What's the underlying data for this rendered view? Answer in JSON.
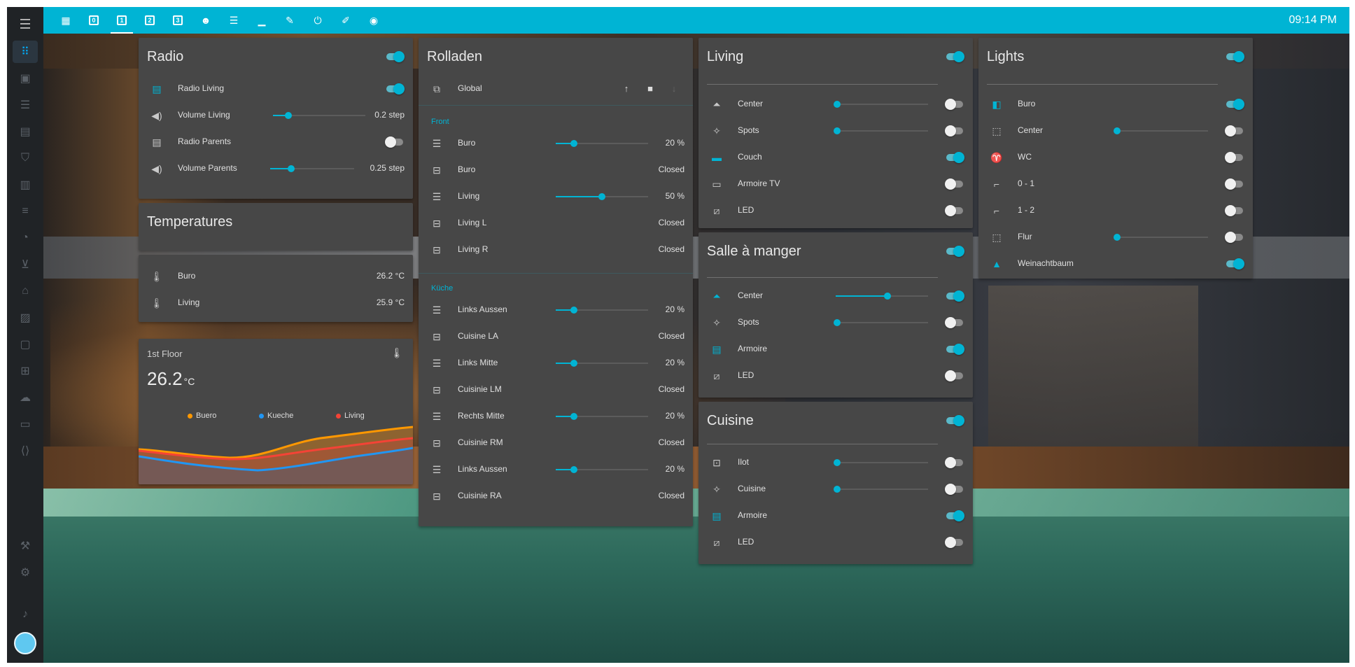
{
  "topbar": {
    "time": "09:14 PM",
    "views": [
      {
        "icon": "floorplan-icon",
        "glyph": "▦"
      },
      {
        "icon": "floor-0-icon",
        "glyph": "0"
      },
      {
        "icon": "floor-1-icon",
        "glyph": "1"
      },
      {
        "icon": "floor-2-icon",
        "glyph": "2"
      },
      {
        "icon": "floor-3-icon",
        "glyph": "3"
      },
      {
        "icon": "robot-icon",
        "glyph": "☻"
      },
      {
        "icon": "server-icon",
        "glyph": "☰"
      },
      {
        "icon": "laptop-icon",
        "glyph": "▁"
      },
      {
        "icon": "wrench-icon",
        "glyph": "✎"
      },
      {
        "icon": "power-icon",
        "glyph": "⏻"
      },
      {
        "icon": "ruler-icon",
        "glyph": "✐"
      },
      {
        "icon": "camera-icon",
        "glyph": "◉"
      }
    ]
  },
  "radio": {
    "title": "Radio",
    "rows": [
      {
        "name": "Radio Living",
        "icon": "radio-icon"
      },
      {
        "name": "Volume Living",
        "icon": "volume-icon",
        "value": "0.2 step"
      },
      {
        "name": "Radio Parents",
        "icon": "radio-icon"
      },
      {
        "name": "Volume Parents",
        "icon": "volume-icon",
        "value": "0.25 step"
      }
    ]
  },
  "temperatures": {
    "title": "Temperatures",
    "rows": [
      {
        "name": "Buro",
        "value": "26.2 °C"
      },
      {
        "name": "Living",
        "value": "25.9 °C"
      }
    ]
  },
  "floor": {
    "title": "1st Floor",
    "value": "26.2",
    "unit": "°C",
    "legend": [
      {
        "name": "Buero",
        "color": "#ff9800"
      },
      {
        "name": "Kueche",
        "color": "#2196f3"
      },
      {
        "name": "Living",
        "color": "#f44336"
      }
    ]
  },
  "rolladen": {
    "title": "Rolladen",
    "global": "Global",
    "section_front": "Front",
    "section_kueche": "Küche",
    "front": [
      {
        "name": "Buro",
        "value": "20 %"
      },
      {
        "name": "Buro",
        "value": "Closed"
      },
      {
        "name": "Living",
        "value": "50 %"
      },
      {
        "name": "Living L",
        "value": "Closed"
      },
      {
        "name": "Living R",
        "value": "Closed"
      }
    ],
    "kueche": [
      {
        "name": "Links Aussen",
        "value": "20 %"
      },
      {
        "name": "Cuisine LA",
        "value": "Closed"
      },
      {
        "name": "Links Mitte",
        "value": "20 %"
      },
      {
        "name": "Cuisinie LM",
        "value": "Closed"
      },
      {
        "name": "Rechts Mitte",
        "value": "20 %"
      },
      {
        "name": "Cuisinie RM",
        "value": "Closed"
      },
      {
        "name": "Links Aussen",
        "value": "20 %"
      },
      {
        "name": "Cuisinie RA",
        "value": "Closed"
      }
    ]
  },
  "living": {
    "title": "Living",
    "rows": [
      {
        "name": "Center"
      },
      {
        "name": "Spots"
      },
      {
        "name": "Couch"
      },
      {
        "name": "Armoire TV"
      },
      {
        "name": "LED"
      }
    ]
  },
  "salle": {
    "title": "Salle à manger",
    "rows": [
      {
        "name": "Center"
      },
      {
        "name": "Spots"
      },
      {
        "name": "Armoire"
      },
      {
        "name": "LED"
      }
    ]
  },
  "cuisine": {
    "title": "Cuisine",
    "rows": [
      {
        "name": "Ilot"
      },
      {
        "name": "Cuisine"
      },
      {
        "name": "Armoire"
      },
      {
        "name": "LED"
      }
    ]
  },
  "lights": {
    "title": "Lights",
    "rows": [
      {
        "name": "Buro"
      },
      {
        "name": "Center"
      },
      {
        "name": "WC"
      },
      {
        "name": "0 - 1"
      },
      {
        "name": "1 - 2"
      },
      {
        "name": "Flur"
      },
      {
        "name": "Weinachtbaum"
      }
    ]
  },
  "colors": {
    "accent": "#00b4d4",
    "card": "#474747",
    "sidebar": "#202326"
  }
}
